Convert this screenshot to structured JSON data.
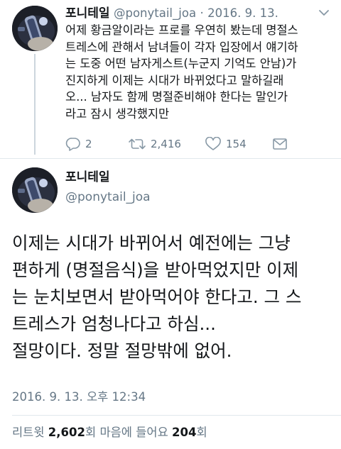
{
  "parent_tweet": {
    "display_name": "포니테일",
    "handle": "@ponytail_joa",
    "separator": "·",
    "date": "2016. 9. 13.",
    "lines": [
      "어제 황금알이라는 프로를 우연히 봤는데 명절스",
      "트레스에 관해서 남녀들이 각자 입장에서 얘기하",
      "는 도중 어떤 남자게스트(누군지 기억도 안남)가",
      "진지하게 이제는 시대가 바뀌었다고 말하길래",
      "오... 남자도 함께 명절준비해야 한다는 말인가",
      "라고 잠시 생각했지만"
    ],
    "reply_count": "2",
    "retweet_count": "2,416",
    "like_count": "154",
    "icons": {
      "caret": "chevron-down-icon",
      "reply": "reply-icon",
      "retweet": "retweet-icon",
      "like": "heart-icon",
      "dm": "envelope-icon"
    }
  },
  "main_tweet": {
    "display_name": "포니테일",
    "handle": "@ponytail_joa",
    "lines": [
      "이제는 시대가 바뀌어서 예전에는 그냥",
      "편하게 (명절음식)을 받아먹었지만 이제",
      "는 눈치보면서 받아먹어야 한다고. 그 스",
      "트레스가 엄청나다고 하심...",
      "절망이다. 정말 절망밖에 없어."
    ],
    "timestamp": "2016. 9. 13. 오후 12:34",
    "retweets_label": "리트윗",
    "retweets_value": "2,602",
    "retweets_unit": "회",
    "likes_label": "마음에 들어요",
    "likes_value": "204",
    "likes_unit": "회"
  },
  "colors": {
    "text": "#14171a",
    "secondary": "#657786",
    "divider": "#e1e8ed",
    "thread_line": "#ccd6dd",
    "icon": "#8899a6"
  }
}
